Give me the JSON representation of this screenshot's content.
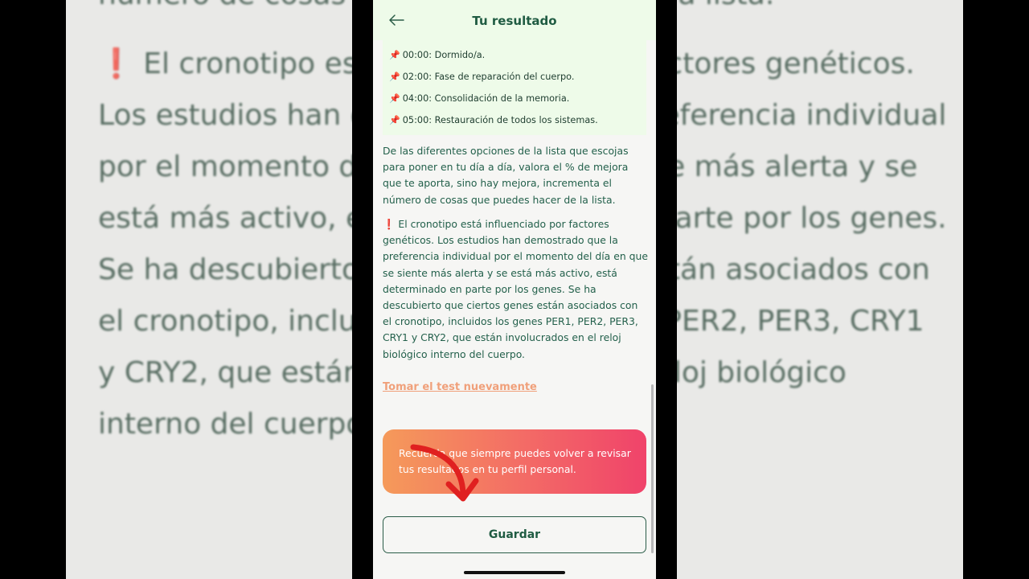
{
  "header": {
    "title": "Tu resultado"
  },
  "schedule": [
    {
      "icon": "pushpin-icon",
      "text": "00:00: Dormido/a."
    },
    {
      "icon": "pushpin-icon",
      "text": "02:00: Fase de reparación del cuerpo."
    },
    {
      "icon": "pushpin-icon",
      "text": "04:00: Consolidación de la memoria."
    },
    {
      "icon": "pushpin-icon",
      "text": "05:00: Restauración de todos los sistemas."
    }
  ],
  "body": {
    "paragraph1": "De las diferentes opciones de la lista que escojas para poner en tu día a día, valora el % de mejora que te aporta, sino hay mejora, incrementa el número de cosas que puedes hacer de la lista.",
    "paragraph2": "El cronotipo está influenciado por factores genéticos. Los estudios han demostrado que la preferencia individual por el momento del día en que se siente más alerta y se está más activo, está determinado en parte por los genes. Se ha descubierto que ciertos genes están asociados con el cronotipo, incluidos los genes PER1, PER2, PER3, CRY1 y CRY2, que están involucrados en el reloj biológico interno del cuerpo."
  },
  "retake_link": "Tomar el test nuevamente",
  "notice": "Recuerda que siempre puedes volver a revisar tus resultados en tu perfil personal.",
  "save_button": "Guardar",
  "background_blur": {
    "line1": "número de cosas que puedes hacer de la lista.",
    "para": "El cronotipo está influenciado por factores genéticos. Los estudios han demostrado que la preferencia individual por el momento del día en que se siente más alerta y se está más activo, está determinado en parte por los genes. Se ha descubierto que ciertos genes están asociados con el cronotipo, incluidos los genes PER1, PER2, PER3, CRY1 y CRY2, que están involucrados en el reloj biológico interno del cuerpo."
  },
  "colors": {
    "accent_green": "#1f5b42",
    "header_bg": "#eefbe9",
    "link_orange": "#f0a07a",
    "notice_gradient_start": "#f59a5a",
    "notice_gradient_end": "#f0436a"
  }
}
